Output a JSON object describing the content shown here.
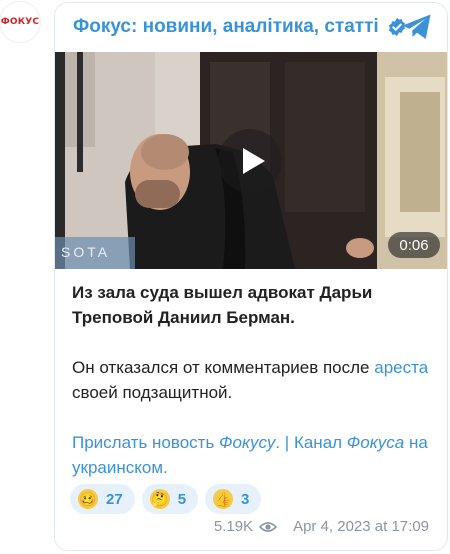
{
  "avatar": {
    "text": "ФОКУС"
  },
  "channel": {
    "name": "Фокус: новини, аналітика, статті"
  },
  "video": {
    "watermark": "SOTA",
    "duration": "0:06"
  },
  "message": {
    "line1": "Из зала суда вышел адвокат Дарьи Треповой Даниил Берман.",
    "p2_part1": "Он отказался от комментариев после ",
    "p2_link": "ареста",
    "p2_part2": " своей подзащитной.",
    "footer_link1": "Прислать новость ",
    "footer_link1_italic": "Фокусу",
    "footer_sep": ". | ",
    "footer_link2": "Канал ",
    "footer_link2_italic": "Фокуса",
    "footer_link2_tail": " на украинском",
    "footer_end": "."
  },
  "reactions": [
    {
      "icon": "woozy-face-icon",
      "emoji": "🥴",
      "count": "27"
    },
    {
      "icon": "thinking-face-icon",
      "emoji": "🤔",
      "count": "5"
    },
    {
      "icon": "thumbs-up-icon",
      "emoji": "👍",
      "count": "3"
    }
  ],
  "meta": {
    "views": "5.19K",
    "timestamp": "Apr 4, 2023 at 17:09"
  },
  "colors": {
    "accent": "#3a93d6",
    "brand_red": "#d2232a",
    "reaction_bg": "#e6f1fb"
  }
}
